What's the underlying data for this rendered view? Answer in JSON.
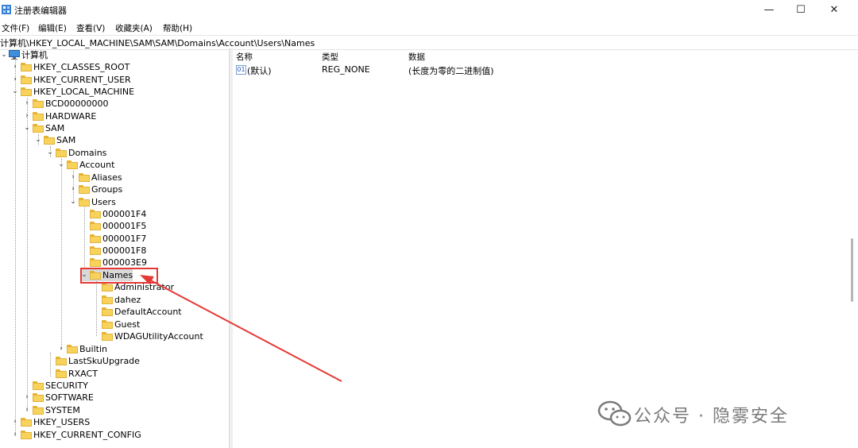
{
  "window": {
    "title": "注册表编辑器",
    "controls": [
      "—",
      "☐",
      "✕"
    ]
  },
  "menu": [
    "文件(F)",
    "编辑(E)",
    "查看(V)",
    "收藏夹(A)",
    "帮助(H)"
  ],
  "address": "计算机\\HKEY_LOCAL_MACHINE\\SAM\\SAM\\Domains\\Account\\Users\\Names",
  "tree": {
    "root": "计算机",
    "nodes": [
      {
        "label": "HKEY_CLASSES_ROOT",
        "state": "collapsed"
      },
      {
        "label": "HKEY_CURRENT_USER",
        "state": "collapsed"
      },
      {
        "label": "HKEY_LOCAL_MACHINE",
        "state": "expanded"
      },
      {
        "label": "BCD00000000",
        "state": "collapsed"
      },
      {
        "label": "HARDWARE",
        "state": "collapsed"
      },
      {
        "label": "SAM",
        "state": "expanded"
      },
      {
        "label": "SAM",
        "state": "expanded"
      },
      {
        "label": "Domains",
        "state": "expanded"
      },
      {
        "label": "Account",
        "state": "expanded"
      },
      {
        "label": "Aliases",
        "state": "collapsed"
      },
      {
        "label": "Groups",
        "state": "collapsed"
      },
      {
        "label": "Users",
        "state": "expanded"
      },
      {
        "label": "000001F4",
        "state": "leaf"
      },
      {
        "label": "000001F5",
        "state": "leaf"
      },
      {
        "label": "000001F7",
        "state": "leaf"
      },
      {
        "label": "000001F8",
        "state": "leaf"
      },
      {
        "label": "000003E9",
        "state": "leaf"
      },
      {
        "label": "Names",
        "state": "expanded",
        "selected": true
      },
      {
        "label": "Administrator",
        "state": "leaf"
      },
      {
        "label": "dahez",
        "state": "leaf"
      },
      {
        "label": "DefaultAccount",
        "state": "leaf"
      },
      {
        "label": "Guest",
        "state": "leaf"
      },
      {
        "label": "WDAGUtilityAccount",
        "state": "leaf"
      },
      {
        "label": "Builtin",
        "state": "collapsed"
      },
      {
        "label": "LastSkuUpgrade",
        "state": "leaf"
      },
      {
        "label": "RXACT",
        "state": "leaf"
      },
      {
        "label": "SECURITY",
        "state": "leaf"
      },
      {
        "label": "SOFTWARE",
        "state": "collapsed"
      },
      {
        "label": "SYSTEM",
        "state": "collapsed"
      },
      {
        "label": "HKEY_USERS",
        "state": "collapsed"
      },
      {
        "label": "HKEY_CURRENT_CONFIG",
        "state": "collapsed"
      }
    ]
  },
  "values_table": {
    "columns": [
      "名称",
      "类型",
      "数据"
    ],
    "rows": [
      {
        "name": "(默认)",
        "type": "REG_NONE",
        "data": "(长度为零的二进制值)",
        "icon": "binary-value-icon"
      }
    ]
  },
  "watermark": {
    "text": "公众号 · 隐雾安全",
    "icon": "wechat-logo-icon"
  },
  "colors": {
    "highlight_box": "#e53935",
    "arrow": "#e53935",
    "folder": "#f8d35b"
  }
}
